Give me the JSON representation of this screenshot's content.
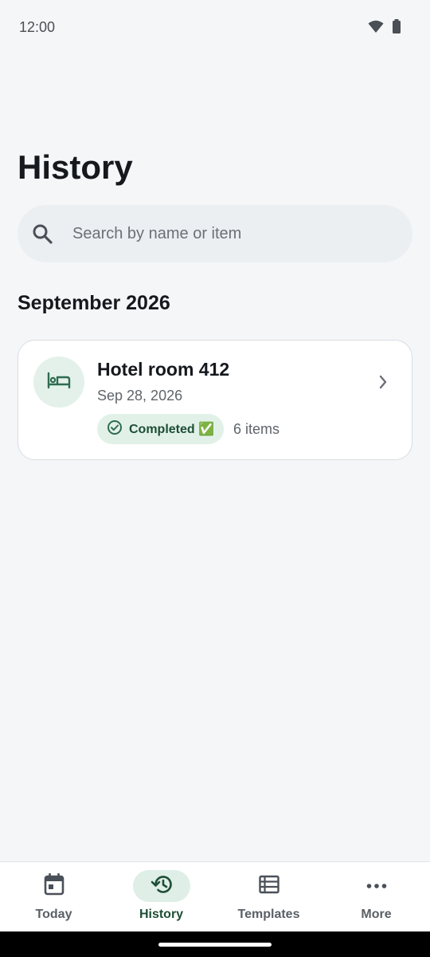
{
  "status_bar": {
    "time": "12:00",
    "icons": [
      "wifi-icon",
      "battery-icon"
    ]
  },
  "header": {
    "title": "History"
  },
  "search": {
    "placeholder": "Search by name or item",
    "value": ""
  },
  "sections": [
    {
      "title": "September 2026",
      "items": [
        {
          "icon": "bed-icon",
          "title": "Hotel room 412",
          "date": "Sep 28, 2026",
          "status": "Completed ✅",
          "count": "6 items"
        }
      ]
    }
  ],
  "bottom_nav": {
    "items": [
      {
        "label": "Today",
        "icon": "calendar-icon",
        "active": false
      },
      {
        "label": "History",
        "icon": "history-icon",
        "active": true
      },
      {
        "label": "Templates",
        "icon": "list-icon",
        "active": false
      },
      {
        "label": "More",
        "icon": "more-icon",
        "active": false
      }
    ]
  },
  "colors": {
    "background": "#f5f6f8",
    "accent": "#1d4e35",
    "accent_light": "#e2f1e8",
    "search_bg": "#eceff2"
  }
}
